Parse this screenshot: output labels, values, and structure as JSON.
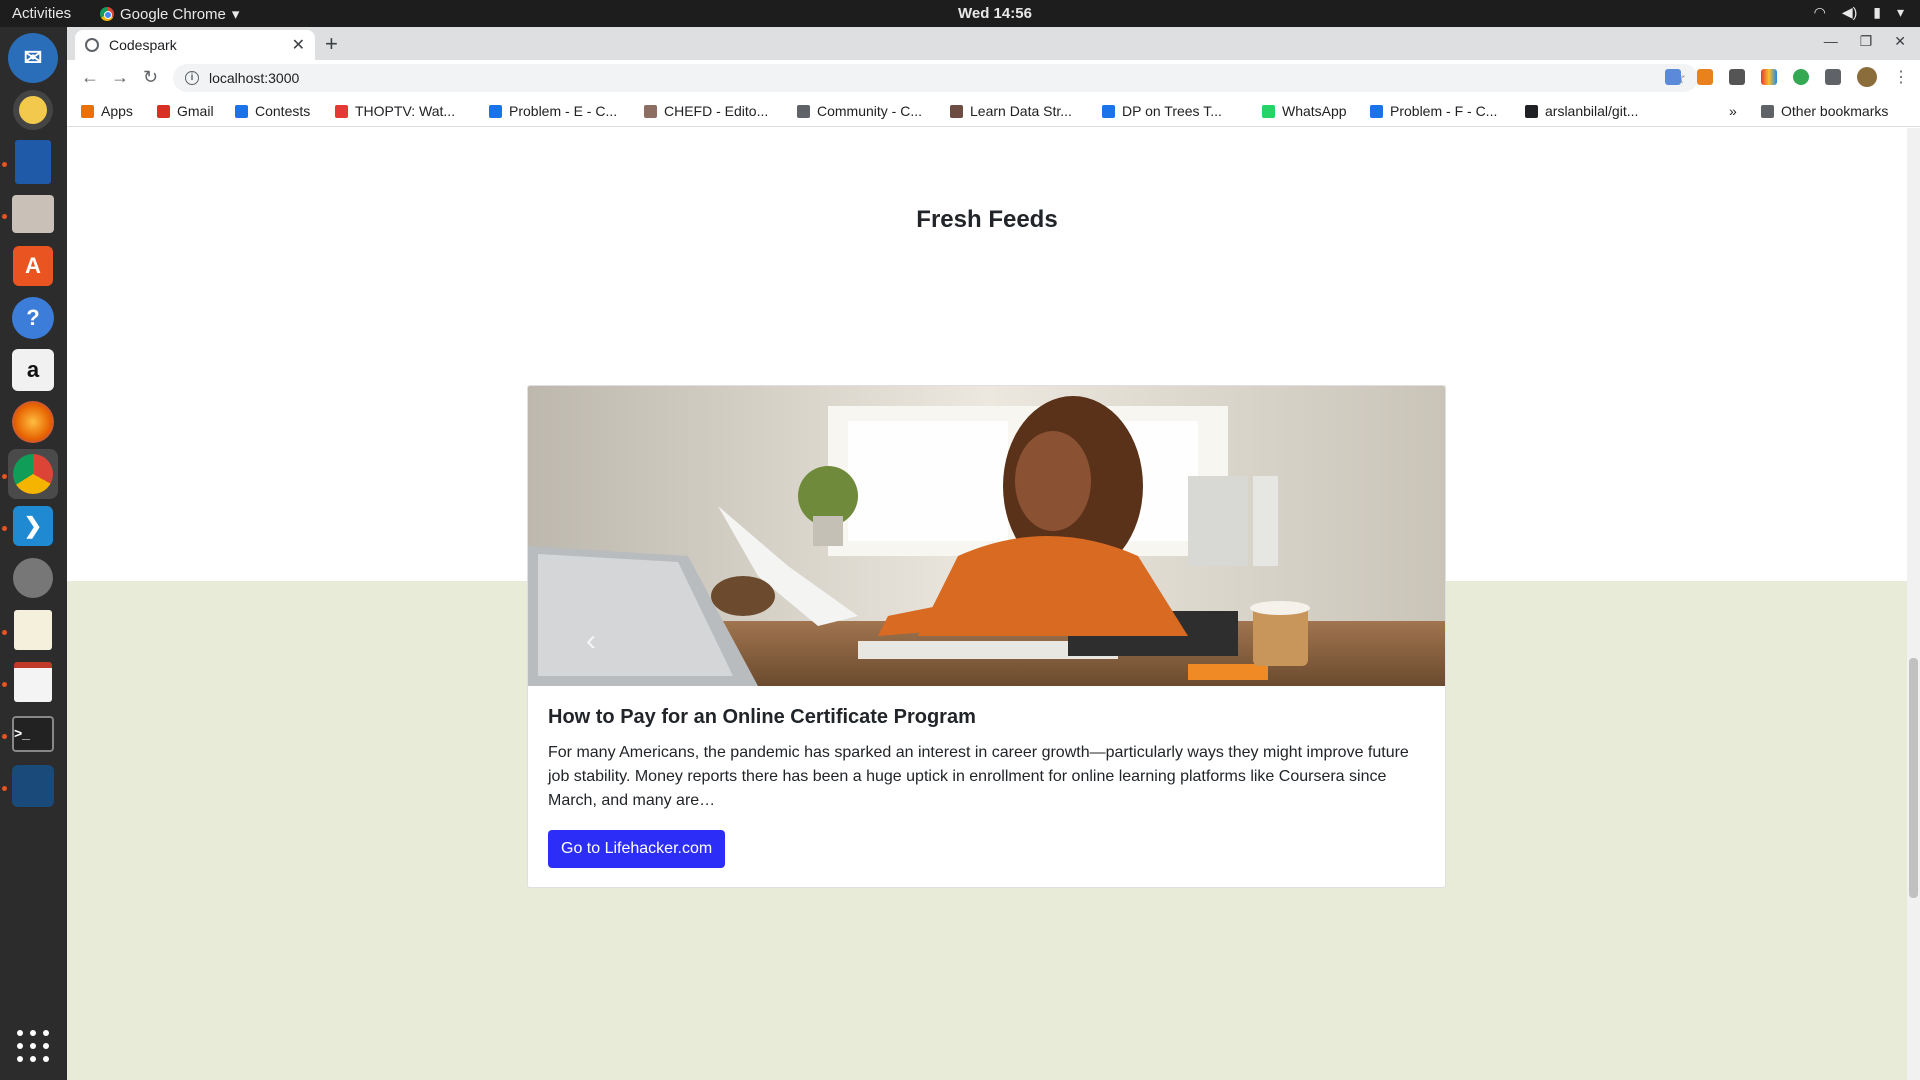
{
  "system": {
    "activities": "Activities",
    "app_name": "Google Chrome",
    "clock": "Wed 14:56"
  },
  "browser": {
    "tab_title": "Codespark",
    "url": "localhost:3000",
    "bookmarks": [
      {
        "label": "Apps",
        "icon": "apps-grid-icon",
        "color": "#e8710a"
      },
      {
        "label": "Gmail",
        "icon": "gmail-icon",
        "color": "#d93025"
      },
      {
        "label": "Contests",
        "icon": "bar-chart-icon",
        "color": "#1a73e8"
      },
      {
        "label": "THOPTV: Wat...",
        "icon": "thoptv-icon",
        "color": "#e53935"
      },
      {
        "label": "Problem - E - C...",
        "icon": "bar-chart-icon",
        "color": "#1a73e8"
      },
      {
        "label": "CHEFD - Edito...",
        "icon": "codechef-icon",
        "color": "#8d6e63"
      },
      {
        "label": "Community - C...",
        "icon": "community-icon",
        "color": "#5f6368"
      },
      {
        "label": "Learn Data Str...",
        "icon": "cc-icon",
        "color": "#6d4c41"
      },
      {
        "label": "DP on Trees T...",
        "icon": "bar-chart-icon",
        "color": "#1a73e8"
      },
      {
        "label": "WhatsApp",
        "icon": "whatsapp-icon",
        "color": "#25d366"
      },
      {
        "label": "Problem - F - C...",
        "icon": "bar-chart-icon",
        "color": "#1a73e8"
      },
      {
        "label": "arslanbilal/git...",
        "icon": "github-icon",
        "color": "#202124"
      }
    ],
    "bookmarks_overflow": "»",
    "other_bookmarks": "Other bookmarks"
  },
  "page": {
    "heading": "Fresh Feeds",
    "card": {
      "title": "How to Pay for an Online Certificate Program",
      "text": "For many Americans, the pandemic has sparked an interest in career growth—particularly ways they might improve future job stability. Money reports there has been a huge uptick in enrollment for online learning platforms like Coursera since March, and many are…",
      "button_label": "Go to Lifehacker.com",
      "button_color": "#2c2ef7"
    },
    "lower_band_color": "#e7ebd8"
  }
}
